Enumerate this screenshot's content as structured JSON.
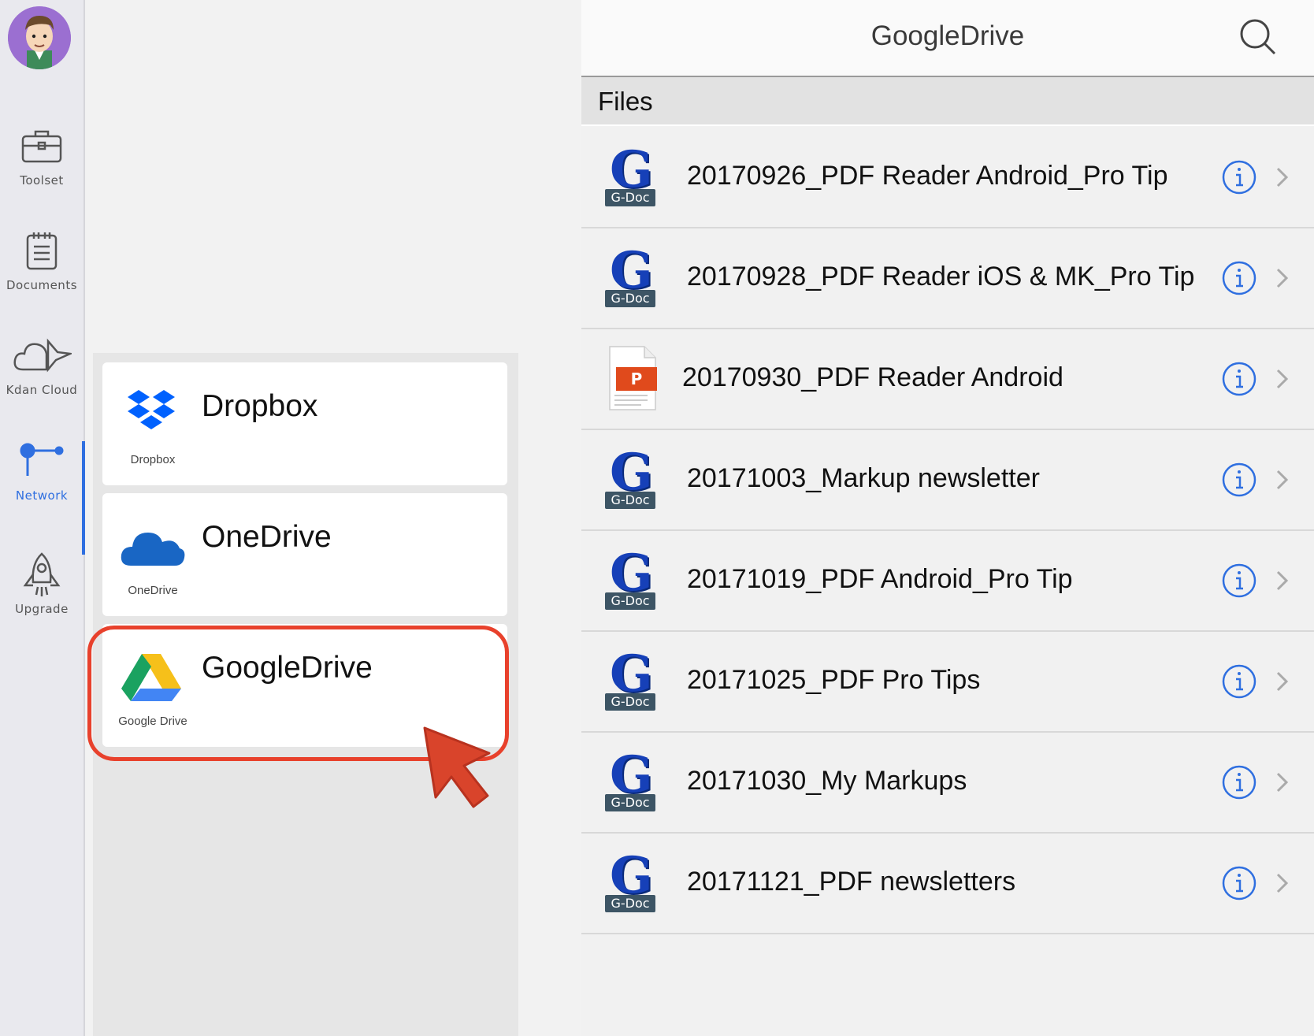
{
  "rail": {
    "items": [
      {
        "label": "Toolset",
        "icon": "toolbox-icon"
      },
      {
        "label": "Documents",
        "icon": "clipboard-icon"
      },
      {
        "label": "Kdan Cloud",
        "icon": "cloud-icon"
      },
      {
        "label": "Network",
        "icon": "network-icon"
      },
      {
        "label": "Upgrade",
        "icon": "rocket-icon"
      }
    ],
    "active": "Network"
  },
  "services": [
    {
      "name": "Dropbox",
      "sub": "Dropbox",
      "icon": "dropbox-icon"
    },
    {
      "name": "OneDrive",
      "sub": "OneDrive",
      "icon": "onedrive-icon"
    },
    {
      "name": "GoogleDrive",
      "sub": "Google Drive",
      "icon": "google-drive-icon"
    }
  ],
  "header": {
    "title": "GoogleDrive"
  },
  "files_header": "Files",
  "files": [
    {
      "name": "20170926_PDF Reader Android_Pro Tip",
      "type": "G-Doc"
    },
    {
      "name": "20170928_PDF Reader iOS & MK_Pro Tip",
      "type": "G-Doc"
    },
    {
      "name": "20170930_PDF Reader Android",
      "type": "P"
    },
    {
      "name": "20171003_Markup newsletter",
      "type": "G-Doc"
    },
    {
      "name": "20171019_PDF Android_Pro Tip",
      "type": "G-Doc"
    },
    {
      "name": "20171025_PDF Pro Tips",
      "type": "G-Doc"
    },
    {
      "name": "20171030_My Markups",
      "type": "G-Doc"
    },
    {
      "name": "20171121_PDF newsletters",
      "type": "G-Doc"
    }
  ],
  "colors": {
    "accent": "#2f6fe0",
    "highlight": "#e8412c"
  }
}
